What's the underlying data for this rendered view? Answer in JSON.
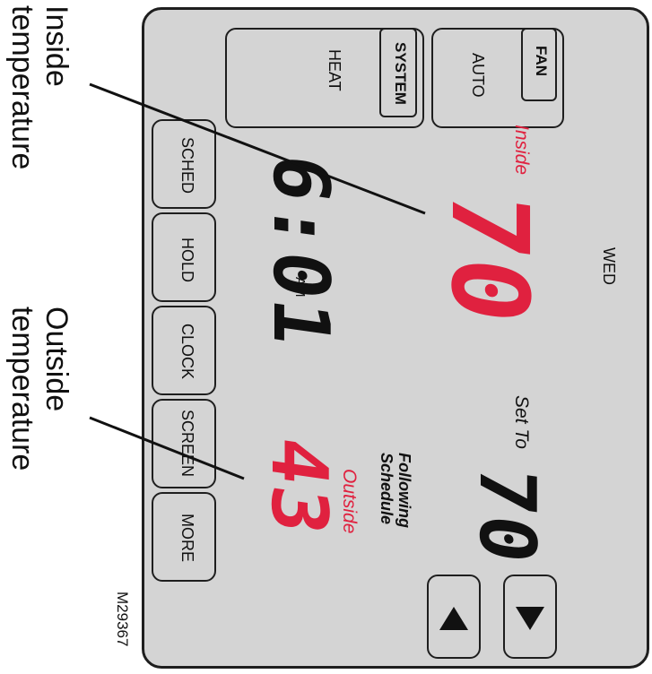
{
  "callouts": {
    "inside": [
      "Inside",
      "temperature"
    ],
    "outside": [
      "Outside",
      "temperature"
    ]
  },
  "thermostat": {
    "fan": {
      "tag": "FAN",
      "value": "AUTO"
    },
    "system": {
      "tag": "SYSTEM",
      "value": "HEAT"
    },
    "inside_label": "Inside",
    "inside_temp": "70",
    "day": "WED",
    "set_to_label": "Set To",
    "set_temp": "70",
    "schedule_status": [
      "Following",
      "Schedule"
    ],
    "outside_label": "Outside",
    "outside_temp": "43",
    "time": "6:01",
    "time_suffix": "AM",
    "buttons": [
      "SCHED",
      "HOLD",
      "CLOCK",
      "SCREEN",
      "MORE"
    ],
    "figure_id": "M29367"
  },
  "colors": {
    "accent_red": "#e0213f",
    "screen_bg": "#d4d4d4",
    "frame": "#1e1e1e"
  }
}
